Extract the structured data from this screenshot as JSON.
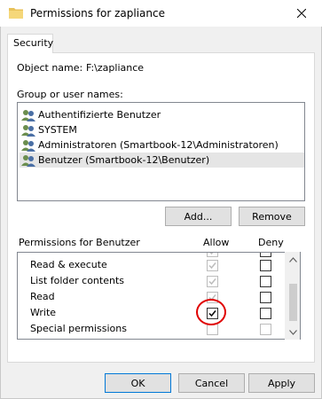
{
  "window": {
    "title": "Permissions for zapliance",
    "icon": "folder-icon"
  },
  "tabs": [
    {
      "label": "Security"
    }
  ],
  "object": {
    "label": "Object name:",
    "value": "F:\\zapliance"
  },
  "groups": {
    "label": "Group or user names:",
    "items": [
      {
        "label": "Authentifizierte Benutzer",
        "icon": "users-icon"
      },
      {
        "label": "SYSTEM",
        "icon": "users-icon"
      },
      {
        "label": "Administratoren (Smartbook-12\\Administratoren)",
        "icon": "users-icon"
      },
      {
        "label": "Benutzer (Smartbook-12\\Benutzer)",
        "icon": "users-icon",
        "selected": true
      }
    ]
  },
  "buttons": {
    "add": "Add...",
    "remove": "Remove",
    "ok": "OK",
    "cancel": "Cancel",
    "apply": "Apply"
  },
  "permissions": {
    "label": "Permissions for Benutzer",
    "allow_header": "Allow",
    "deny_header": "Deny",
    "rows": [
      {
        "name": "Read & execute",
        "allow": true,
        "allow_disabled": true,
        "deny": false,
        "deny_disabled": false
      },
      {
        "name": "List folder contents",
        "allow": true,
        "allow_disabled": true,
        "deny": false,
        "deny_disabled": false
      },
      {
        "name": "Read",
        "allow": true,
        "allow_disabled": true,
        "deny": false,
        "deny_disabled": false
      },
      {
        "name": "Write",
        "allow": true,
        "allow_disabled": false,
        "deny": false,
        "deny_disabled": false
      },
      {
        "name": "Special permissions",
        "allow": false,
        "allow_disabled": true,
        "deny": false,
        "deny_disabled": true
      }
    ]
  },
  "colors": {
    "highlight": "#e00000",
    "selected_row": "#e5e5e5"
  }
}
